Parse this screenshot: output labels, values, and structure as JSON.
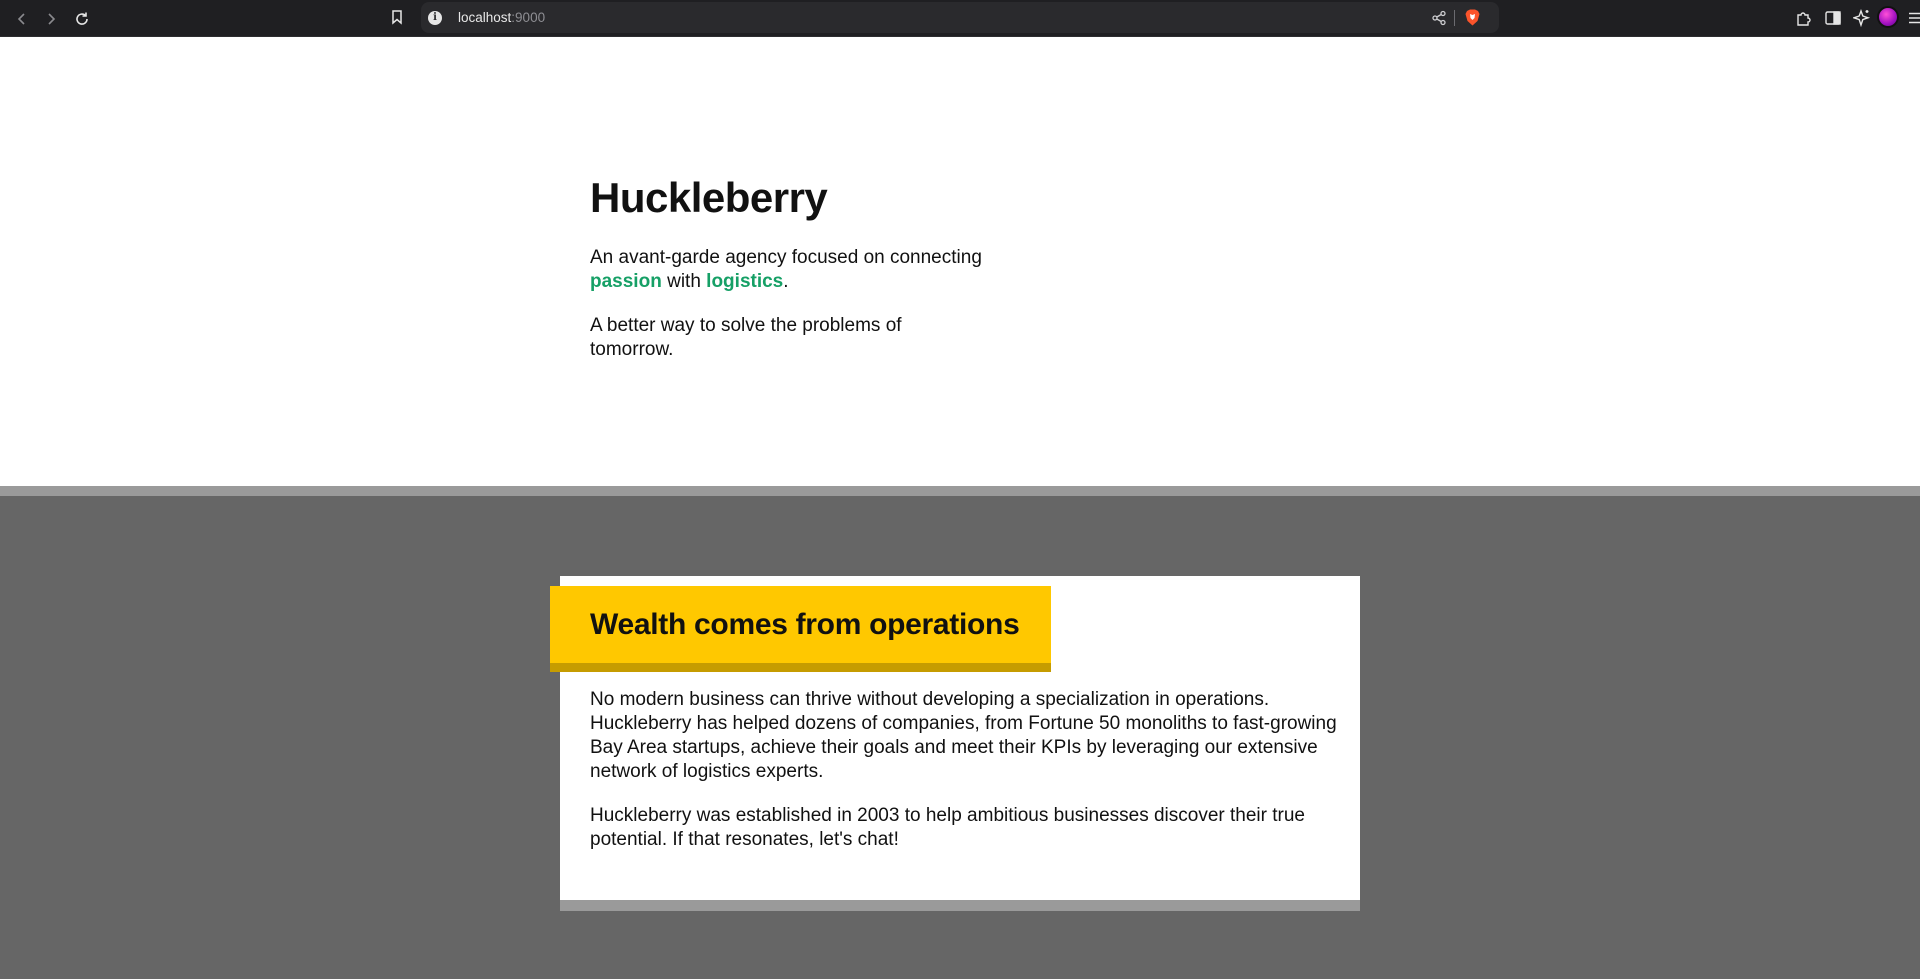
{
  "browser": {
    "url_host": "localhost",
    "url_port": ":9000",
    "icons": {
      "back": "back-arrow-icon",
      "forward": "forward-arrow-icon",
      "reload": "reload-icon",
      "bookmark": "bookmark-icon",
      "site_info": "info-icon",
      "share": "share-icon",
      "brave_shields": "brave-lion-icon",
      "extensions": "puzzle-icon",
      "sidebar": "sidebar-icon",
      "leo": "ai-sparkle-icon",
      "profile": "profile-avatar",
      "menu": "hamburger-menu-icon"
    }
  },
  "hero": {
    "title": "Huckleberry",
    "tagline_before": "An avant-garde agency focused on connecting ",
    "tagline_word1": "passion",
    "tagline_middle": " with ",
    "tagline_word2": "logistics",
    "tagline_after": ".",
    "subline": "A better way to solve the problems of tomorrow."
  },
  "feature": {
    "heading": "Wealth comes from operations",
    "paragraph1": "No modern business can thrive without developing a specialization in operations. Huckleberry has helped dozens of companies, from Fortune 50 monoliths to fast-growing Bay Area startups, achieve their goals and meet their KPIs by leveraging our extensive network of logistics experts.",
    "paragraph2": "Huckleberry was established in 2003 to help ambitious businesses discover their true potential. If that resonates, let's chat!"
  },
  "colors": {
    "accent_green": "#16a066",
    "heading_yellow": "#ffc800",
    "heading_yellow_shadow": "#c69c00",
    "band_gray": "#666666",
    "band_top_gray": "#9a9a9a"
  }
}
